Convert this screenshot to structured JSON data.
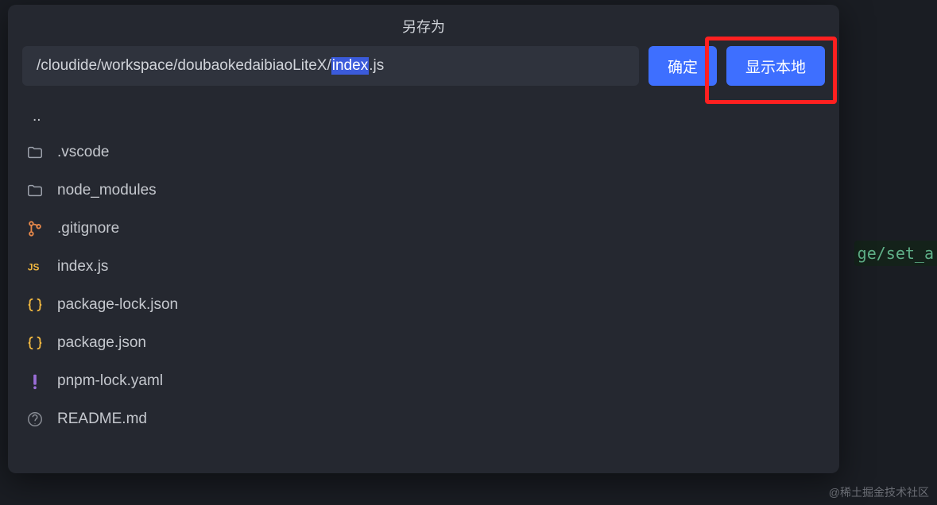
{
  "dialog": {
    "title": "另存为",
    "path_prefix": "/cloudide/workspace/doubaokedaibiaoLiteX/",
    "path_selected": "index",
    "path_suffix": ".js",
    "confirm_label": "确定",
    "show_local_label": "显示本地"
  },
  "files": {
    "parent": "..",
    "items": [
      {
        "icon": "folder",
        "name": ".vscode"
      },
      {
        "icon": "folder",
        "name": "node_modules"
      },
      {
        "icon": "git",
        "name": ".gitignore"
      },
      {
        "icon": "js",
        "name": "index.js"
      },
      {
        "icon": "json",
        "name": "package-lock.json"
      },
      {
        "icon": "json",
        "name": "package.json"
      },
      {
        "icon": "yaml",
        "name": "pnpm-lock.yaml"
      },
      {
        "icon": "readme",
        "name": "README.md"
      }
    ]
  },
  "background": {
    "code_fragment": "ge/set_a"
  },
  "watermark": "@稀土掘金技术社区"
}
